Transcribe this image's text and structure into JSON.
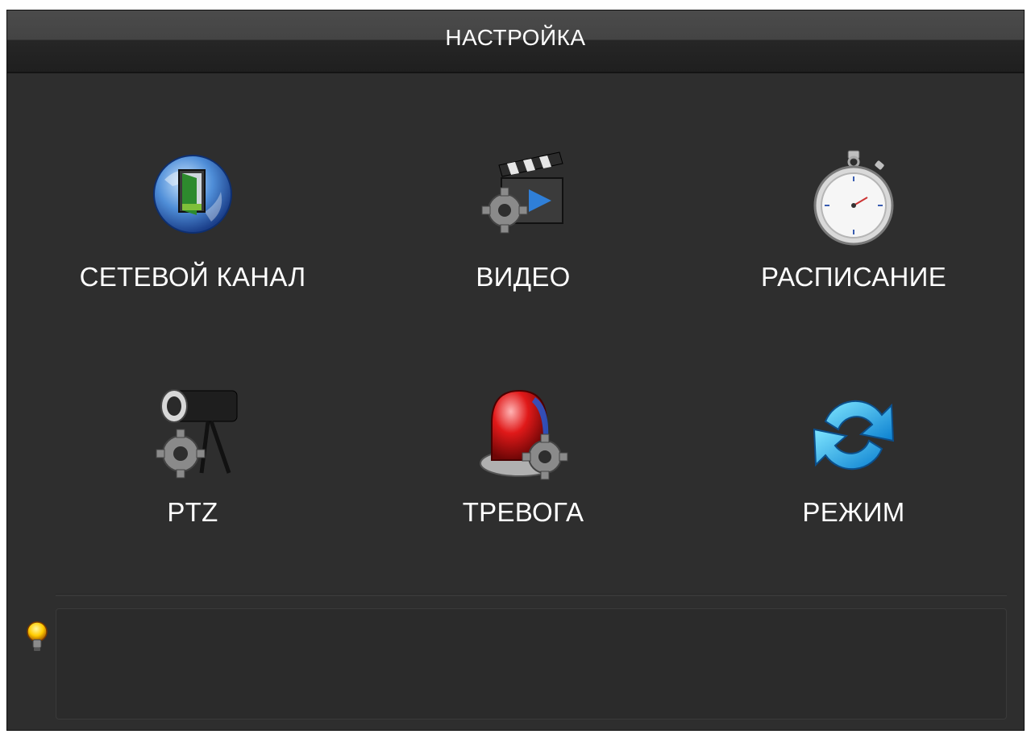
{
  "window": {
    "title": "НАСТРОЙКА"
  },
  "menu": {
    "items": [
      {
        "label": "СЕТЕВОЙ КАНАЛ",
        "icon": "globe-door-icon"
      },
      {
        "label": "ВИДЕО",
        "icon": "video-clapper-gear-icon"
      },
      {
        "label": "РАСПИСАНИЕ",
        "icon": "stopwatch-icon"
      },
      {
        "label": "PTZ",
        "icon": "ptz-camera-gear-icon"
      },
      {
        "label": "ТРЕВОГА",
        "icon": "alarm-siren-gear-icon"
      },
      {
        "label": "РЕЖИМ",
        "icon": "refresh-cycle-icon"
      }
    ]
  },
  "hint": {
    "icon": "lightbulb-icon",
    "text": ""
  },
  "colors": {
    "background": "#2e2e2e",
    "titlebar_dark": "#1f1f1f",
    "text": "#ffffff"
  }
}
